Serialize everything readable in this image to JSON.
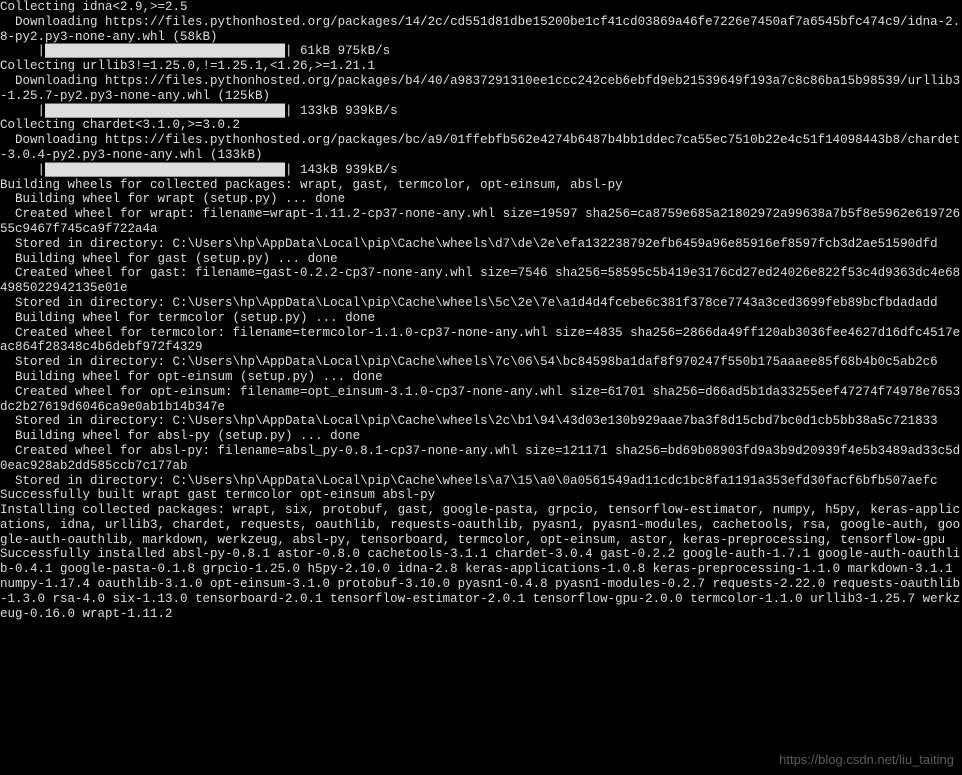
{
  "lines": [
    "Collecting idna<2.9,>=2.5",
    "  Downloading https://files.pythonhosted.org/packages/14/2c/cd551d81dbe15200be1cf41cd03869a46fe7226e7450af7a6545bfc474c9/idna-2.8-py2.py3-none-any.whl (58kB)",
    "     |████████████████████████████████| 61kB 975kB/s",
    "Collecting urllib3!=1.25.0,!=1.25.1,<1.26,>=1.21.1",
    "  Downloading https://files.pythonhosted.org/packages/b4/40/a9837291310ee1ccc242ceb6ebfd9eb21539649f193a7c8c86ba15b98539/urllib3-1.25.7-py2.py3-none-any.whl (125kB)",
    "     |████████████████████████████████| 133kB 939kB/s",
    "Collecting chardet<3.1.0,>=3.0.2",
    "  Downloading https://files.pythonhosted.org/packages/bc/a9/01ffebfb562e4274b6487b4bb1ddec7ca55ec7510b22e4c51f14098443b8/chardet-3.0.4-py2.py3-none-any.whl (133kB)",
    "     |████████████████████████████████| 143kB 939kB/s",
    "Building wheels for collected packages: wrapt, gast, termcolor, opt-einsum, absl-py",
    "  Building wheel for wrapt (setup.py) ... done",
    "  Created wheel for wrapt: filename=wrapt-1.11.2-cp37-none-any.whl size=19597 sha256=ca8759e685a21802972a99638a7b5f8e5962e61972655c9467f745ca9f722a4a",
    "  Stored in directory: C:\\Users\\hp\\AppData\\Local\\pip\\Cache\\wheels\\d7\\de\\2e\\efa132238792efb6459a96e85916ef8597fcb3d2ae51590dfd",
    "  Building wheel for gast (setup.py) ... done",
    "  Created wheel for gast: filename=gast-0.2.2-cp37-none-any.whl size=7546 sha256=58595c5b419e3176cd27ed24026e822f53c4d9363dc4e684985022942135e01e",
    "  Stored in directory: C:\\Users\\hp\\AppData\\Local\\pip\\Cache\\wheels\\5c\\2e\\7e\\a1d4d4fcebe6c381f378ce7743a3ced3699feb89bcfbdadadd",
    "  Building wheel for termcolor (setup.py) ... done",
    "  Created wheel for termcolor: filename=termcolor-1.1.0-cp37-none-any.whl size=4835 sha256=2866da49ff120ab3036fee4627d16dfc4517eac864f28348c4b6debf972f4329",
    "  Stored in directory: C:\\Users\\hp\\AppData\\Local\\pip\\Cache\\wheels\\7c\\06\\54\\bc84598ba1daf8f970247f550b175aaaee85f68b4b0c5ab2c6",
    "  Building wheel for opt-einsum (setup.py) ... done",
    "  Created wheel for opt-einsum: filename=opt_einsum-3.1.0-cp37-none-any.whl size=61701 sha256=d66ad5b1da33255eef47274f74978e7653dc2b27619d6046ca9e0ab1b14b347e",
    "  Stored in directory: C:\\Users\\hp\\AppData\\Local\\pip\\Cache\\wheels\\2c\\b1\\94\\43d03e130b929aae7ba3f8d15cbd7bc0d1cb5bb38a5c721833",
    "  Building wheel for absl-py (setup.py) ... done",
    "  Created wheel for absl-py: filename=absl_py-0.8.1-cp37-none-any.whl size=121171 sha256=bd69b08903fd9a3b9d20939f4e5b3489ad33c5d0eac928ab2dd585ccb7c177ab",
    "  Stored in directory: C:\\Users\\hp\\AppData\\Local\\pip\\Cache\\wheels\\a7\\15\\a0\\0a0561549ad11cdc1bc8fa1191a353efd30facf6bfb507aefc",
    "Successfully built wrapt gast termcolor opt-einsum absl-py",
    "Installing collected packages: wrapt, six, protobuf, gast, google-pasta, grpcio, tensorflow-estimator, numpy, h5py, keras-applications, idna, urllib3, chardet, requests, oauthlib, requests-oauthlib, pyasn1, pyasn1-modules, cachetools, rsa, google-auth, google-auth-oauthlib, markdown, werkzeug, absl-py, tensorboard, termcolor, opt-einsum, astor, keras-preprocessing, tensorflow-gpu",
    "Successfully installed absl-py-0.8.1 astor-0.8.0 cachetools-3.1.1 chardet-3.0.4 gast-0.2.2 google-auth-1.7.1 google-auth-oauthlib-0.4.1 google-pasta-0.1.8 grpcio-1.25.0 h5py-2.10.0 idna-2.8 keras-applications-1.0.8 keras-preprocessing-1.1.0 markdown-3.1.1 numpy-1.17.4 oauthlib-3.1.0 opt-einsum-3.1.0 protobuf-3.10.0 pyasn1-0.4.8 pyasn1-modules-0.2.7 requests-2.22.0 requests-oauthlib-1.3.0 rsa-4.0 six-1.13.0 tensorboard-2.0.1 tensorflow-estimator-2.0.1 tensorflow-gpu-2.0.0 termcolor-1.1.0 urllib3-1.25.7 werkzeug-0.16.0 wrapt-1.11.2"
  ],
  "watermark": "https://blog.csdn.net/liu_taiting"
}
